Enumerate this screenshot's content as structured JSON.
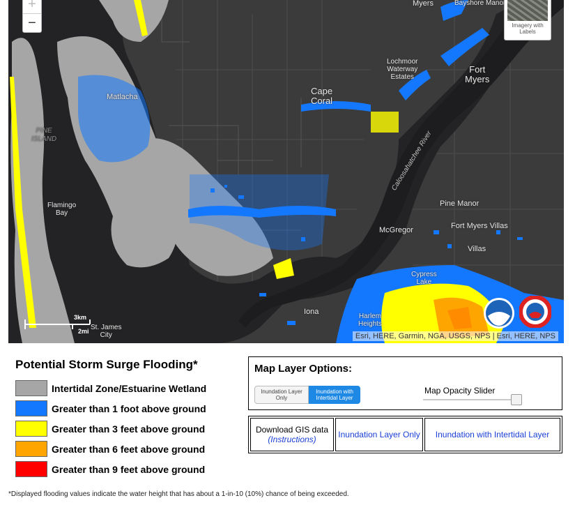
{
  "map": {
    "labels": {
      "myers_top": "Myers",
      "bayshore": "Bayshore Manor",
      "matlacha": "Matlacha",
      "pine_island": "PINE\nISLAND",
      "cape_coral": "Cape\nCoral",
      "lochmoor": "Lochmoor\nWaterway\nEstates",
      "fort_myers": "Fort\nMyers",
      "river": "Caloosahatchee River",
      "flamingo": "Flamingo\nBay",
      "pine_manor": "Pine Manor",
      "mcgregor": "McGregor",
      "fmv": "Fort Myers Villas",
      "villas": "Villas",
      "cypress": "Cypress\nLake",
      "iona": "Iona",
      "harlem": "Harlem\nHeights",
      "st_james": "St. James\nCity"
    },
    "zoom_in": "+",
    "zoom_out": "−",
    "imagery_toggle": "Imagery with\nLabels",
    "scale": {
      "km": "3km",
      "mi": "2mi"
    },
    "attribution": "Esri, HERE, Garmin, NGA, USGS, NPS | Esri, HERE, NPS",
    "colors": {
      "land": "#3b3b3b",
      "water": "#232325",
      "wetland": "#a6a6a6",
      "ft1": "#1478ff",
      "ft3": "#ffff00",
      "ft6": "#ffa500"
    },
    "badges": [
      "noaa-logo",
      "nws-logo"
    ]
  },
  "legend": {
    "title": "Potential Storm Surge Flooding*",
    "items": [
      {
        "label": "Intertidal Zone/Estuarine Wetland",
        "color": "#a6a6a6"
      },
      {
        "label": "Greater than 1 foot above ground",
        "color": "#1478ff"
      },
      {
        "label": "Greater than 3 feet above ground",
        "color": "#ffff00"
      },
      {
        "label": "Greater than 6 feet above ground",
        "color": "#ffa500"
      },
      {
        "label": "Greater than 9 feet above ground",
        "color": "#ff0000"
      }
    ]
  },
  "options": {
    "title": "Map Layer Options:",
    "btn_inundation_only": "Inundation Layer\nOnly",
    "btn_inundation_intertidal": "Inundation with\nIntertidal Layer",
    "selected": "Inundation with Intertidal Layer",
    "opacity_label": "Map Opacity Slider",
    "opacity_value": 1.0
  },
  "gis": {
    "title": "Download GIS data",
    "instructions": "(Instructions)",
    "link1": "Inundation Layer Only",
    "link2": "Inundation with Intertidal Layer"
  },
  "footnote": "*Displayed flooding values indicate the water height that has about a 1-in-10 (10%) chance of being exceeded."
}
